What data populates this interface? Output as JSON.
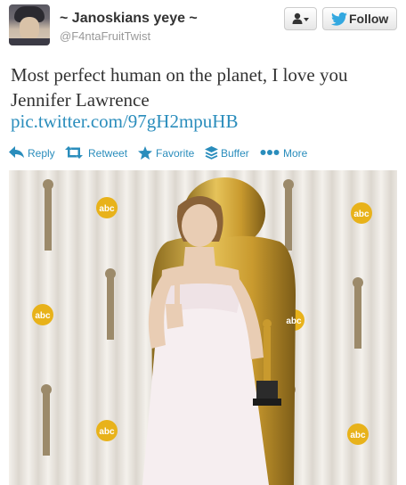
{
  "user": {
    "display_name": "~ Janoskians yeye ~",
    "handle": "@F4ntaFruitTwist"
  },
  "buttons": {
    "follow_label": "Follow"
  },
  "tweet": {
    "text": "Most perfect human on the planet, I love you Jennifer Lawrence",
    "link": "pic.twitter.com/97gH2mpuHB"
  },
  "actions": [
    {
      "label": "Reply",
      "icon": "reply-arrow-icon"
    },
    {
      "label": "Retweet",
      "icon": "retweet-icon"
    },
    {
      "label": "Favorite",
      "icon": "star-icon"
    },
    {
      "label": "Buffer",
      "icon": "buffer-stack-icon"
    },
    {
      "label": "More",
      "icon": "more-dots-icon"
    }
  ],
  "photo": {
    "logo_text": "abc"
  },
  "colors": {
    "link_blue": "#2a8dbc",
    "twitter_bird": "#33a8e0",
    "text": "#333333",
    "muted": "#999999"
  }
}
